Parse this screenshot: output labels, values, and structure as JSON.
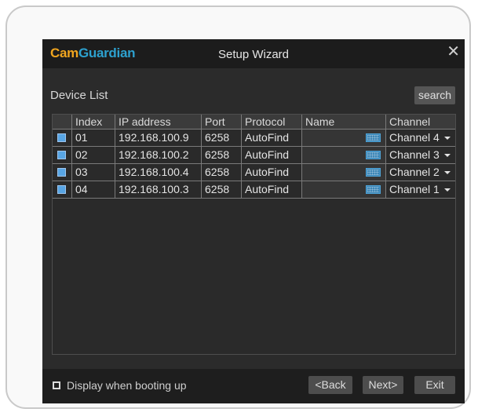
{
  "app": {
    "logo_cam": "Cam",
    "logo_guardian": "Guardian",
    "title": "Setup Wizard",
    "close_glyph": "✕"
  },
  "device_list": {
    "label": "Device List",
    "search_label": "search"
  },
  "table": {
    "headers": [
      "",
      "Index",
      "IP address",
      "Port",
      "Protocol",
      "Name",
      "Channel"
    ],
    "rows": [
      {
        "checked": true,
        "index": "01",
        "ip": "192.168.100.9",
        "port": "6258",
        "protocol": "AutoFind",
        "name": "",
        "channel": "Channel 4"
      },
      {
        "checked": true,
        "index": "02",
        "ip": "192.168.100.2",
        "port": "6258",
        "protocol": "AutoFind",
        "name": "",
        "channel": "Channel 3"
      },
      {
        "checked": true,
        "index": "03",
        "ip": "192.168.100.4",
        "port": "6258",
        "protocol": "AutoFind",
        "name": "",
        "channel": "Channel 2"
      },
      {
        "checked": true,
        "index": "04",
        "ip": "192.168.100.3",
        "port": "6258",
        "protocol": "AutoFind",
        "name": "",
        "channel": "Channel 1"
      }
    ]
  },
  "footer": {
    "boot_label": "Display when booting up",
    "boot_checked": false,
    "back_label": "<Back",
    "next_label": "Next>",
    "exit_label": "Exit"
  },
  "icons": {
    "keyboard": "keyboard-icon",
    "dropdown": "chevron-down-icon",
    "close": "close-icon"
  },
  "colors": {
    "logo_cam": "#f0a51f",
    "logo_guardian": "#2da1cf",
    "checkbox": "#58a5e4",
    "window_bg": "#2b2b2b"
  }
}
